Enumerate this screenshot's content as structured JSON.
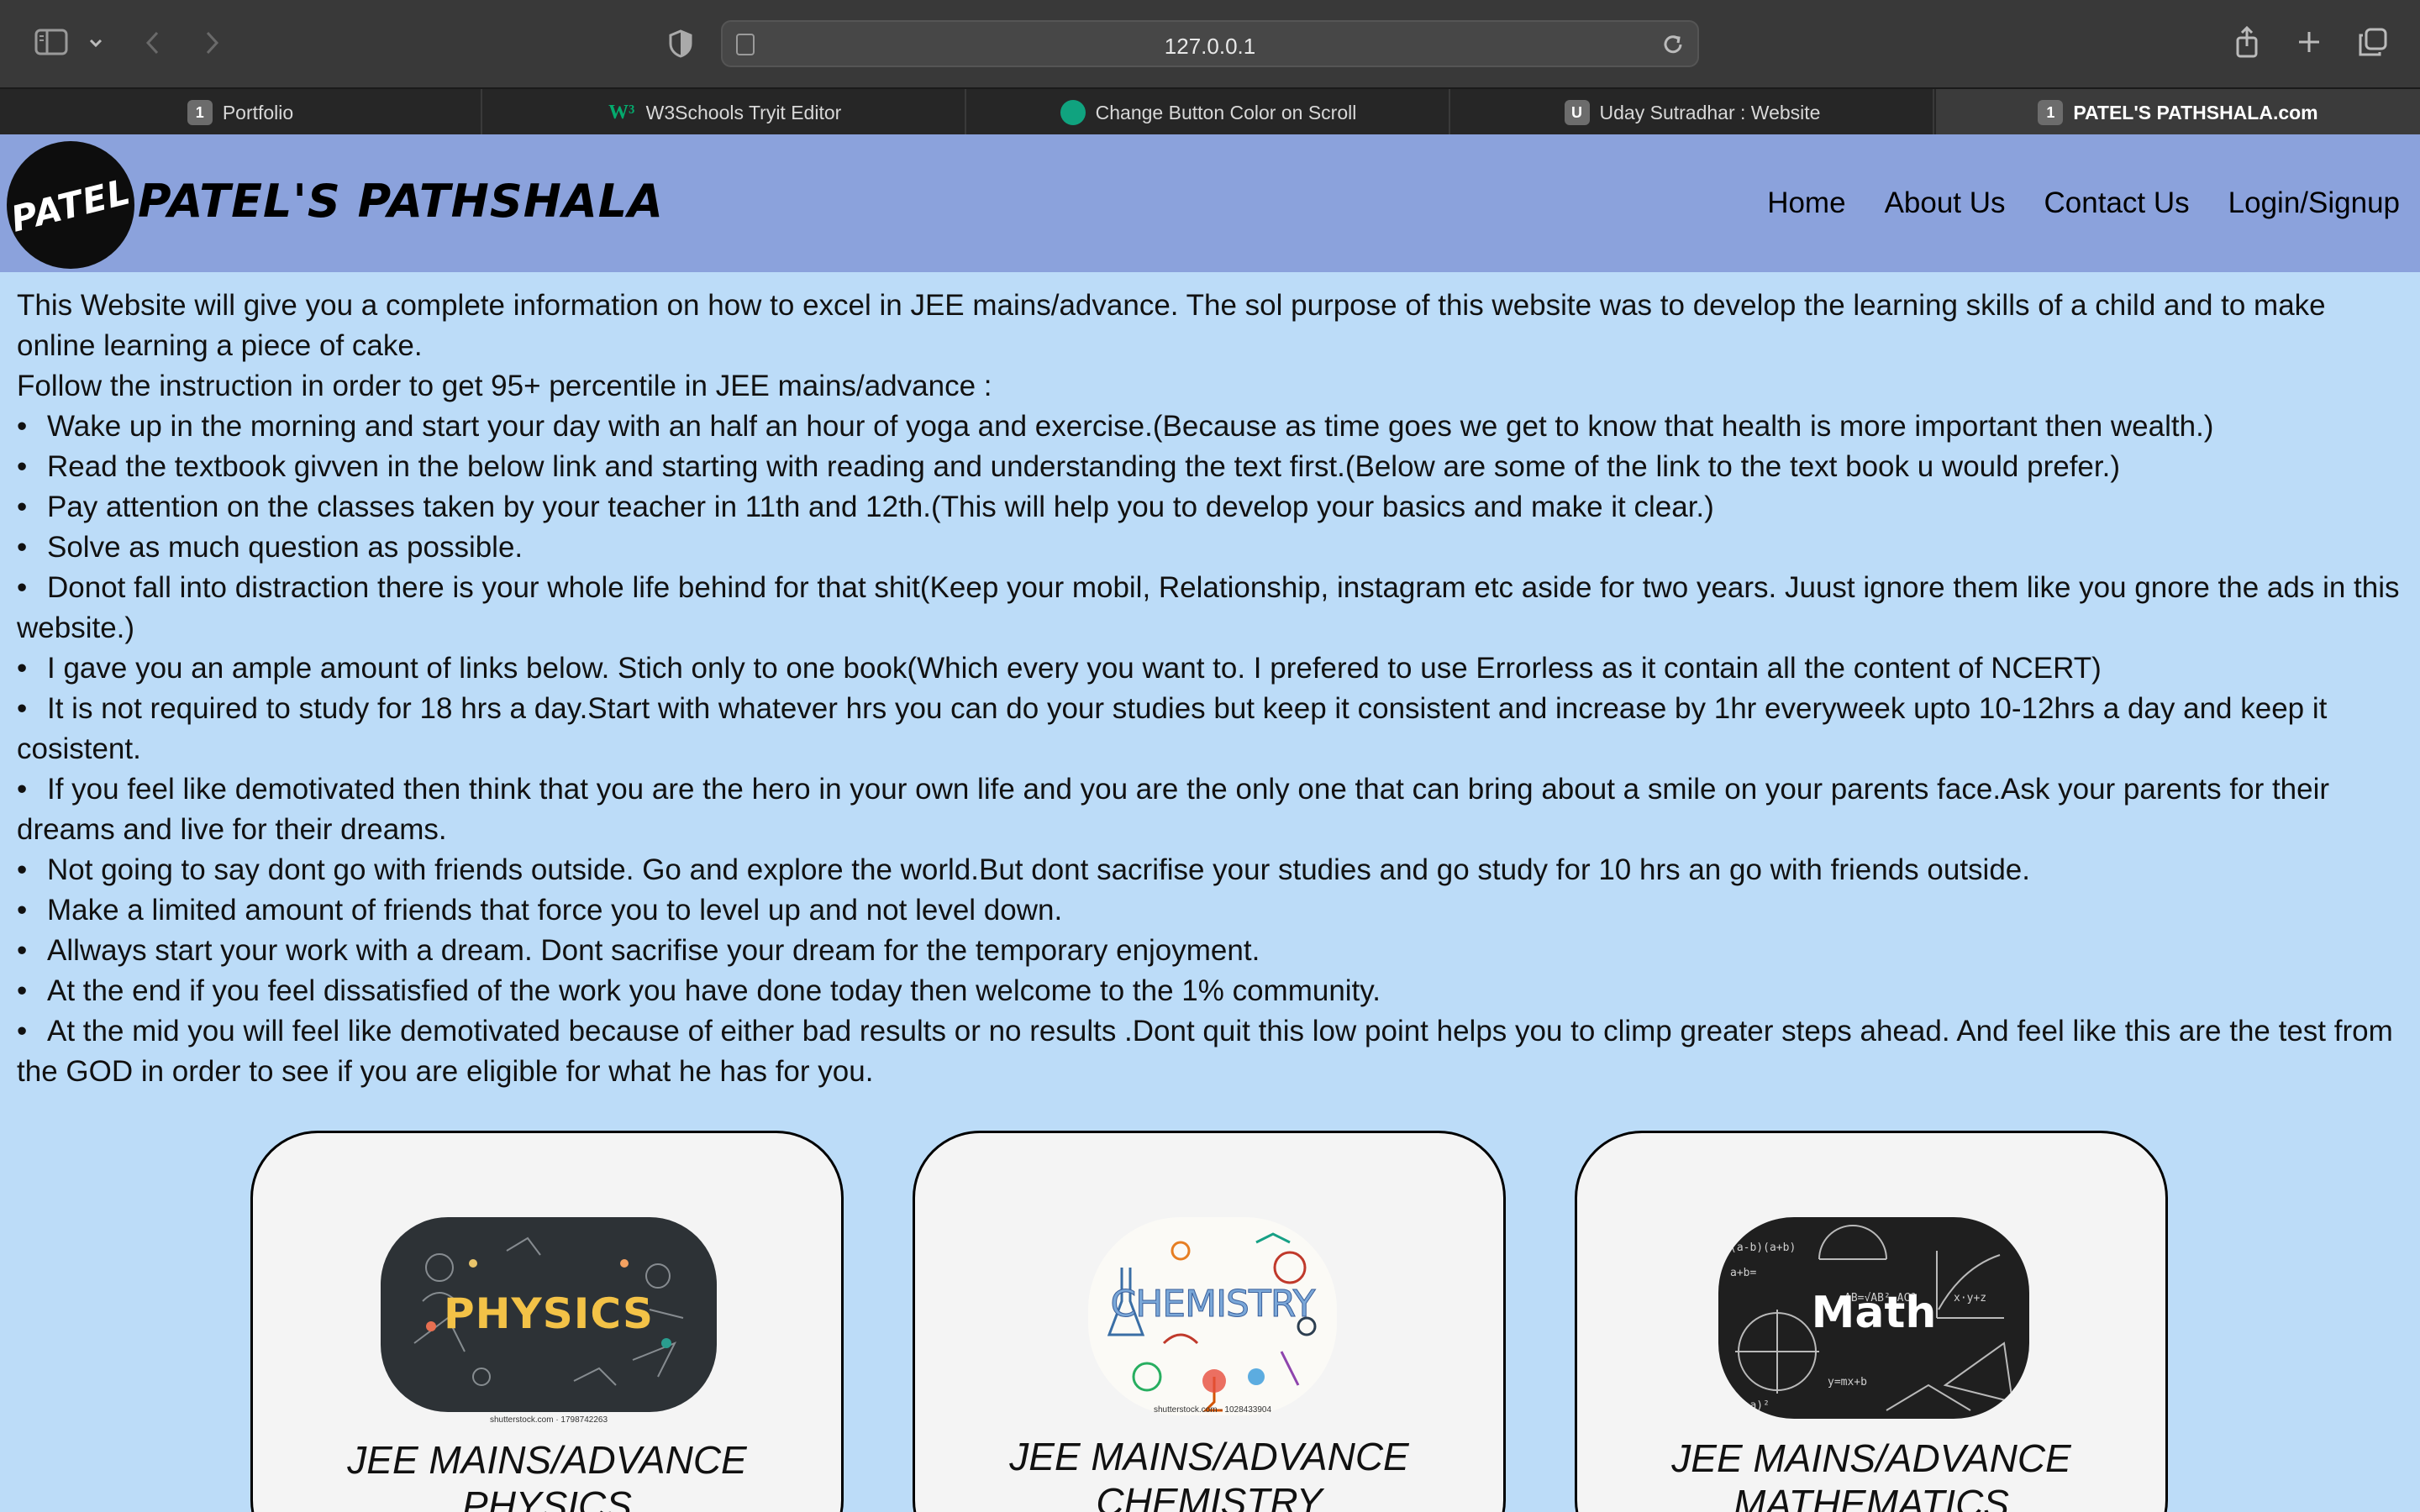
{
  "browser": {
    "url": "127.0.0.1",
    "tabs": [
      {
        "badge": "1",
        "label": "Portfolio"
      },
      {
        "badge": "W³",
        "label": "W3Schools Tryit Editor"
      },
      {
        "badge": "",
        "label": "Change Button Color on Scroll"
      },
      {
        "badge": "U",
        "label": "Uday Sutradhar : Website"
      },
      {
        "badge": "1",
        "label": "PATEL'S PATHSHALA.com"
      }
    ]
  },
  "header": {
    "logo_text": "PATEL",
    "brand": "PATEL'S PATHSHALA",
    "nav": [
      "Home",
      "About Us",
      "Contact Us",
      "Login/Signup"
    ]
  },
  "content": {
    "intro": "This Website will give you a complete information on how to excel in JEE mains/advance. The sol purpose of this website was to develop the learning skills of a child and to make online learning a piece of cake.",
    "follow": "Follow the instruction in order to get 95+ percentile in JEE mains/advance :",
    "points": [
      "Wake up in the morning and start your day with an half an hour of yoga and exercise.(Because as time goes we get to know that health is more important then wealth.)",
      "Read the textbook givven in the below link and starting with reading and understanding the text first.(Below are some of the link to the text book u would prefer.)",
      "Pay attention on the classes taken by your teacher in 11th and 12th.(This will help you to develop your basics and make it clear.)",
      "Solve as much question as possible.",
      "Donot fall into distraction there is your whole life behind for that shit(Keep your mobil, Relationship, instagram etc aside for two years. Juust ignore them like you gnore the ads in this website.)",
      "I gave you an ample amount of links below. Stich only to one book(Which every you want to. I prefered to use Errorless as it contain all the content of NCERT)",
      "It is not required to study for 18 hrs a day.Start with whatever hrs you can do your studies but keep it consistent and increase by 1hr everyweek upto 10-12hrs a day and keep it cosistent.",
      "If you feel like demotivated then think that you are the hero in your own life and you are the only one that can bring about a smile on your parents face.Ask your parents for their dreams and live for their dreams.",
      "Not going to say dont go with friends outside. Go and explore the world.But dont sacrifise your studies and go study for 10 hrs an go with friends outside.",
      "Make a limited amount of friends that force you to level up and not level down.",
      "Allways start your work with a dream. Dont sacrifise your dream for the temporary enjoyment.",
      "At the end if you feel dissatisfied of the work you have done today then welcome to the 1% community.",
      "At the mid you will feel like demotivated because of either bad results or no results .Dont quit this low point helps you to climp greater steps ahead. And feel like this are the test from the GOD in order to see if you are eligible for what he has for you."
    ]
  },
  "cards": [
    {
      "image_text": "PHYSICS",
      "credit": "shutterstock.com · 1798742263",
      "title": "JEE MAINS/ADVANCE PHYSICS"
    },
    {
      "image_text": "CHEMISTRY",
      "credit": "shutterstock.com · 1028433904",
      "title": "JEE MAINS/ADVANCE CHEMISTRY"
    },
    {
      "image_text": "Math",
      "credit": "",
      "title": "JEE MAINS/ADVANCE MATHEMATICS"
    }
  ]
}
